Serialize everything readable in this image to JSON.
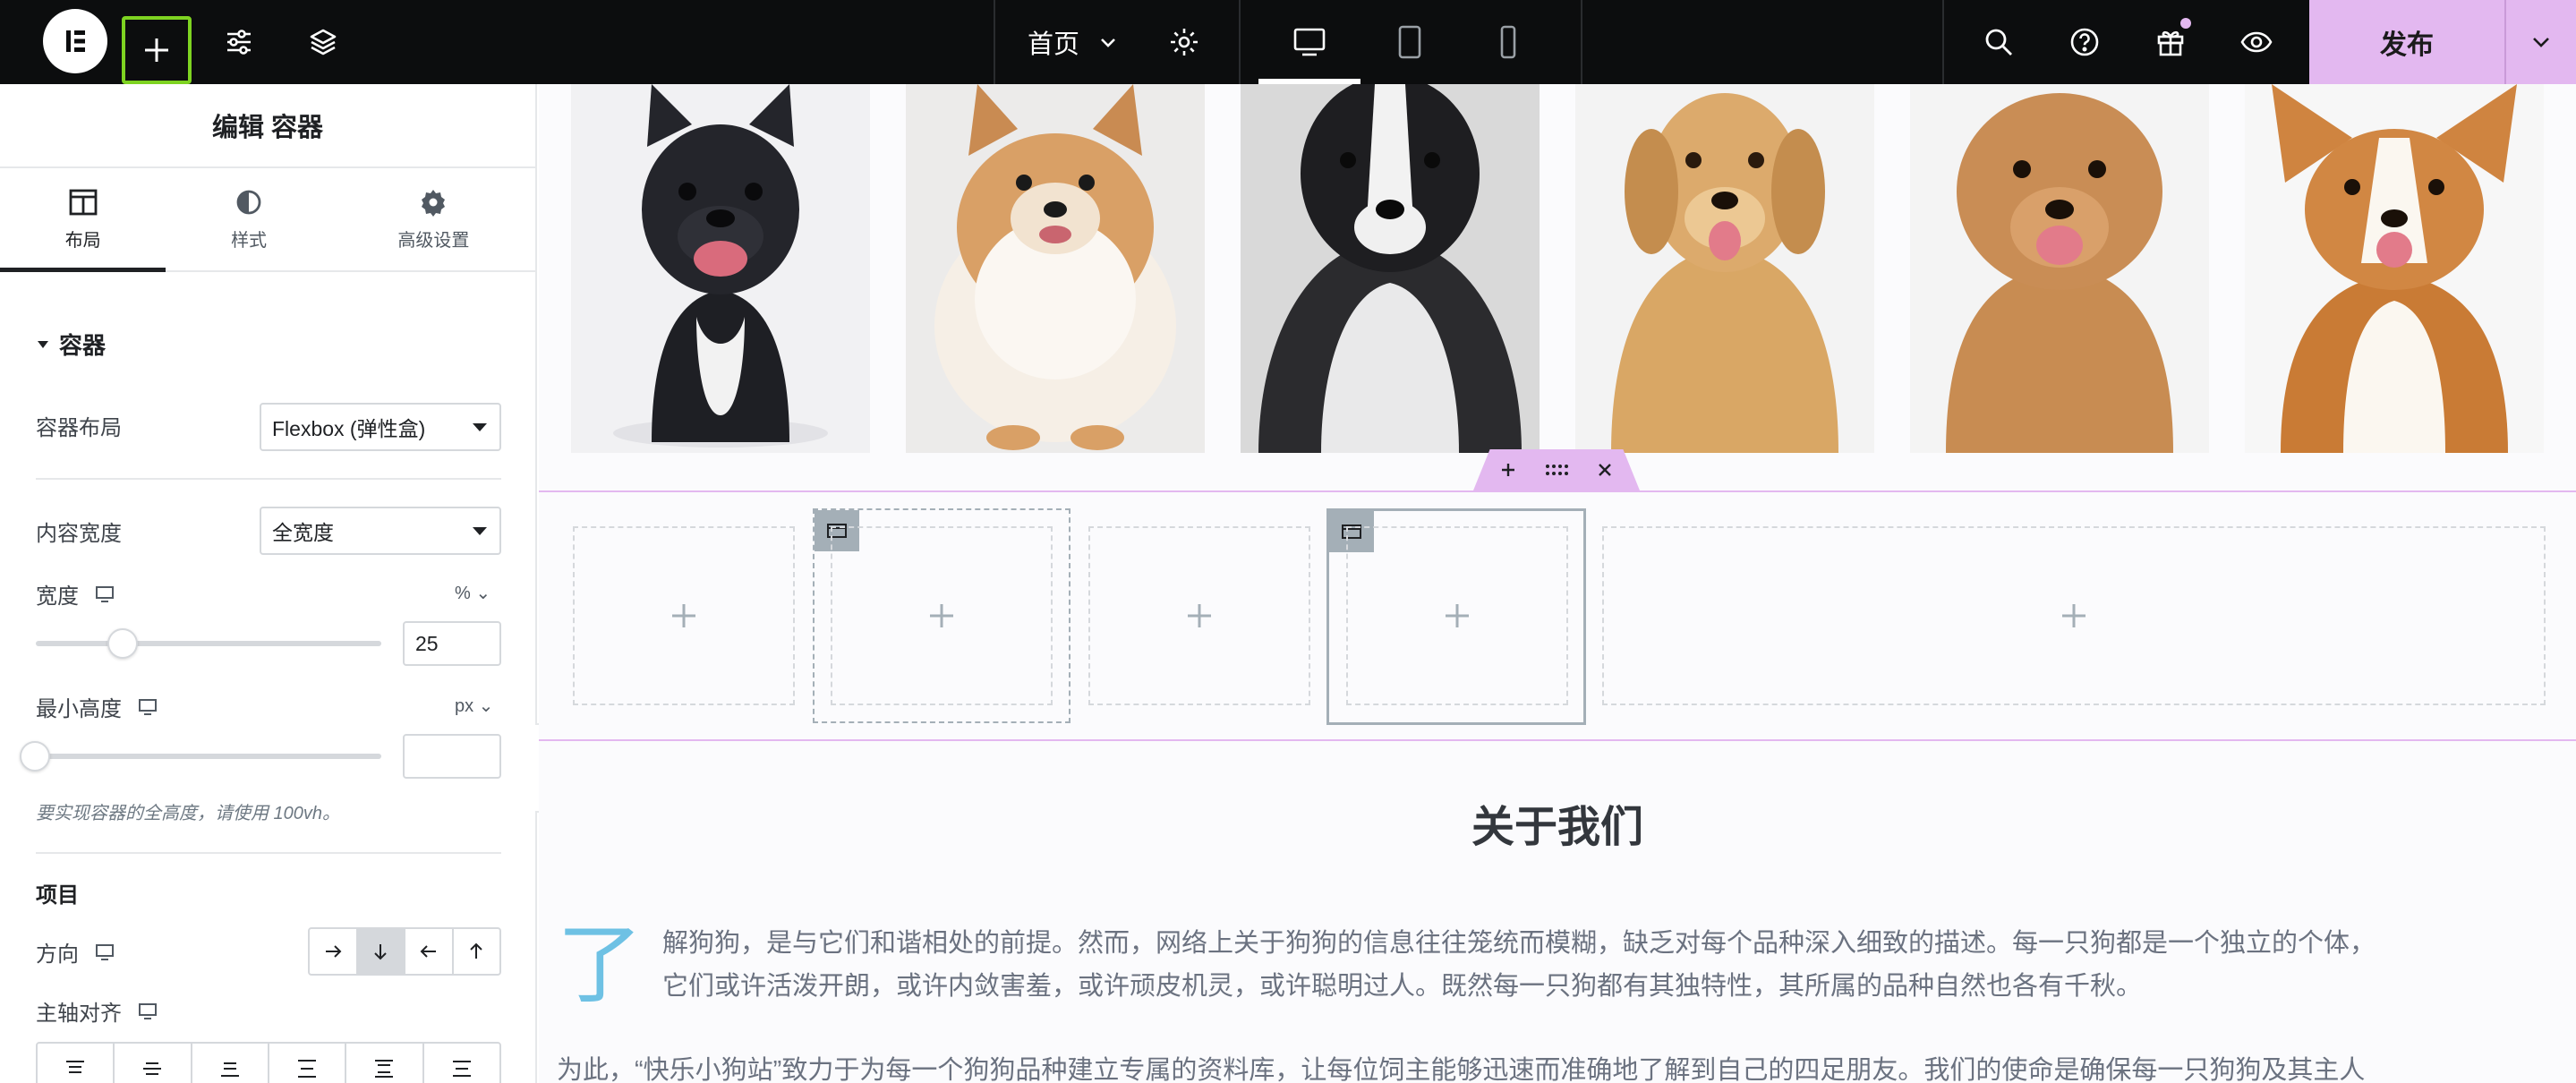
{
  "topbar": {
    "page_name": "首页",
    "publish_label": "发布",
    "icons": [
      "elementor-logo-icon",
      "add-element-icon",
      "site-settings-icon",
      "structure-layers-icon",
      "chevron-down-icon",
      "page-settings-gear-icon",
      "desktop-icon",
      "tablet-icon",
      "mobile-icon",
      "search-icon",
      "help-icon",
      "gift-icon",
      "preview-eye-icon"
    ]
  },
  "panel": {
    "title": "编辑 容器",
    "tabs": [
      {
        "label": "布局",
        "icon": "layout-icon"
      },
      {
        "label": "样式",
        "icon": "style-contrast-icon"
      },
      {
        "label": "高级设置",
        "icon": "advanced-gear-icon"
      }
    ],
    "section_title": "容器",
    "container_layout_label": "容器布局",
    "container_layout_value": "Flexbox (弹性盒)",
    "content_width_label": "内容宽度",
    "content_width_value": "全宽度",
    "width_label": "宽度",
    "width_unit": "% ⌄",
    "width_value": "25",
    "width_slider_fraction": 0.25,
    "min_height_label": "最小高度",
    "min_height_unit": "px ⌄",
    "min_height_value": "",
    "min_height_slider_fraction": 0,
    "min_height_hint": "要实现容器的全高度，请使用 100vh。",
    "items_heading": "项目",
    "direction_label": "方向",
    "main_axis_label": "主轴对齐"
  },
  "canvas": {
    "about_title": "关于我们",
    "dropcap": "了",
    "para_line1": "解狗狗，是与它们和谐相处的前提。然而，网络上关于狗狗的信息往往笼统而模糊，缺乏对每个品种深入细致的描述。每一只狗都是一个独立的个体，",
    "para_line2": "它们或许活泼开朗，或许内敛害羞，或许顽皮机灵，或许聪明过人。既然每一只狗都有其独特性，其所属的品种自然也各有千秋。",
    "para_line3": "为此，“快乐小狗站”致力于为每一个狗狗品种建立专属的资料库，让每位饲主能够迅速而准确地了解到自己的四足朋友。我们的使命是确保每一只狗狗及其主人"
  },
  "colors": {
    "accent_pink": "#e3b8f0",
    "add_highlight": "#7ed321",
    "dropcap_blue": "#6ec1e4"
  }
}
